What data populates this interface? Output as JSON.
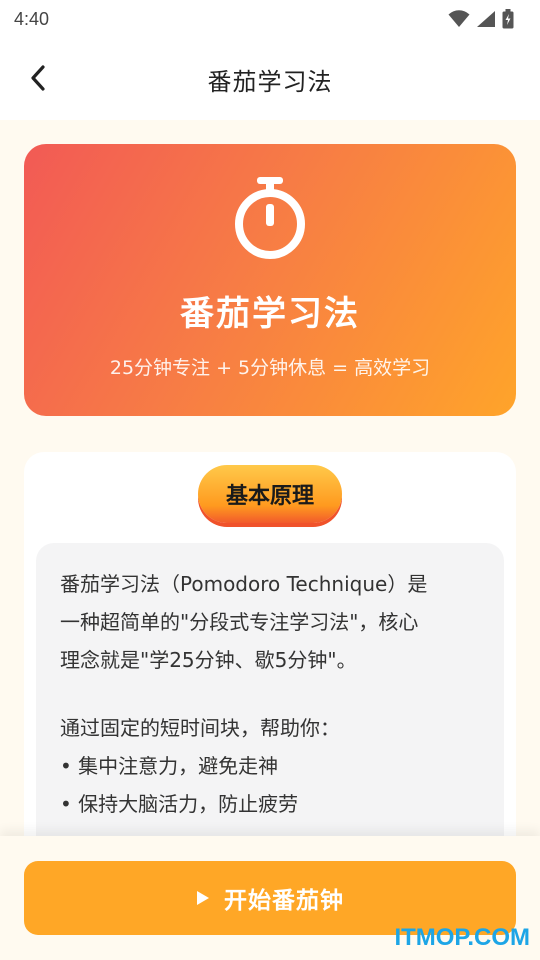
{
  "status_bar": {
    "time": "4:40",
    "icons": [
      "wifi-icon",
      "signal-icon",
      "battery-icon"
    ]
  },
  "nav": {
    "title": "番茄学习法",
    "back_icon": "chevron-left-icon"
  },
  "hero": {
    "icon": "stopwatch-icon",
    "title": "番茄学习法",
    "subtitle": "25分钟专注 + 5分钟休息 = 高效学习",
    "gradient": [
      "#f25a55",
      "#ffa42a"
    ]
  },
  "principle": {
    "badge": "基本原理",
    "paragraph1_line1": "番茄学习法（Pomodoro Technique）是",
    "paragraph1_line2": "一种超简单的\"分段式专注学习法\"，核心",
    "paragraph1_line3": "理念就是\"学25分钟、歇5分钟\"。",
    "paragraph2_intro": "通过固定的短时间块，帮助你：",
    "bullets": [
      "• 集中注意力，避免走神",
      "• 保持大脑活力，防止疲劳"
    ]
  },
  "actions": {
    "start_label": "开始番茄钟",
    "start_icon": "play-icon",
    "accent": "#ffa726"
  },
  "watermark": "ITMOP.COM"
}
